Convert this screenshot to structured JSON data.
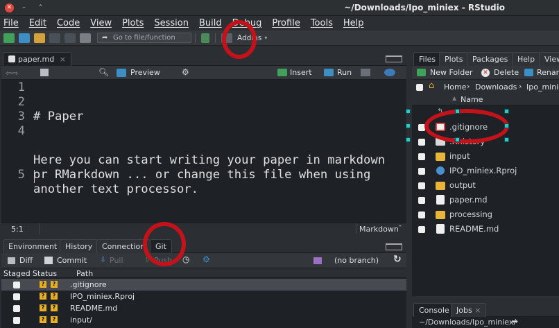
{
  "window": {
    "title": "~/Downloads/Ipo_miniex - RStudio"
  },
  "menu": [
    "File",
    "Edit",
    "Code",
    "View",
    "Plots",
    "Session",
    "Build",
    "Debug",
    "Profile",
    "Tools",
    "Help"
  ],
  "toolbar": {
    "goto_placeholder": "Go to file/function",
    "addins": "Addins"
  },
  "editor": {
    "tab": "paper.md",
    "preview": "Preview",
    "insert": "Insert",
    "run": "Run",
    "lines": [
      {
        "n": "1",
        "text": "# Paper"
      },
      {
        "n": "2",
        "text": ""
      },
      {
        "n": "3",
        "text": ""
      },
      {
        "n": "4",
        "text": "Here you can start writing your paper in markdown\nor RMarkdown ... or change this file when using\nanother text processor."
      },
      {
        "n": "5",
        "text": ""
      }
    ],
    "position": "5:1",
    "mode": "Markdown"
  },
  "lower": {
    "tabs": [
      "Environment",
      "History",
      "Connection",
      "Git"
    ],
    "diff": "Diff",
    "commit": "Commit",
    "pull": "Pull",
    "push": "Push",
    "branch": "(no branch)",
    "headers": {
      "staged": "Staged",
      "status": "Status",
      "path": "Path"
    },
    "rows": [
      ".gitignore",
      "IPO_miniex.Rproj",
      "README.md",
      "input/"
    ]
  },
  "files": {
    "tabs": [
      "Files",
      "Plots",
      "Packages",
      "Help",
      "View"
    ],
    "new_folder": "New Folder",
    "delete": "Delete",
    "rename": "Renam",
    "breadcrumb": {
      "home": "Home",
      "sep": "›",
      "downloads": "Downloads",
      "current": "Ipo_minie"
    },
    "name_header": "Name",
    "items": [
      ".gitignore",
      ".Rhistory",
      "input",
      "IPO_miniex.Rproj",
      "output",
      "paper.md",
      "processing",
      "README.md"
    ]
  },
  "console": {
    "tabs": [
      "Console",
      "Jobs"
    ],
    "path": "~/Downloads/Ipo_miniex/"
  }
}
